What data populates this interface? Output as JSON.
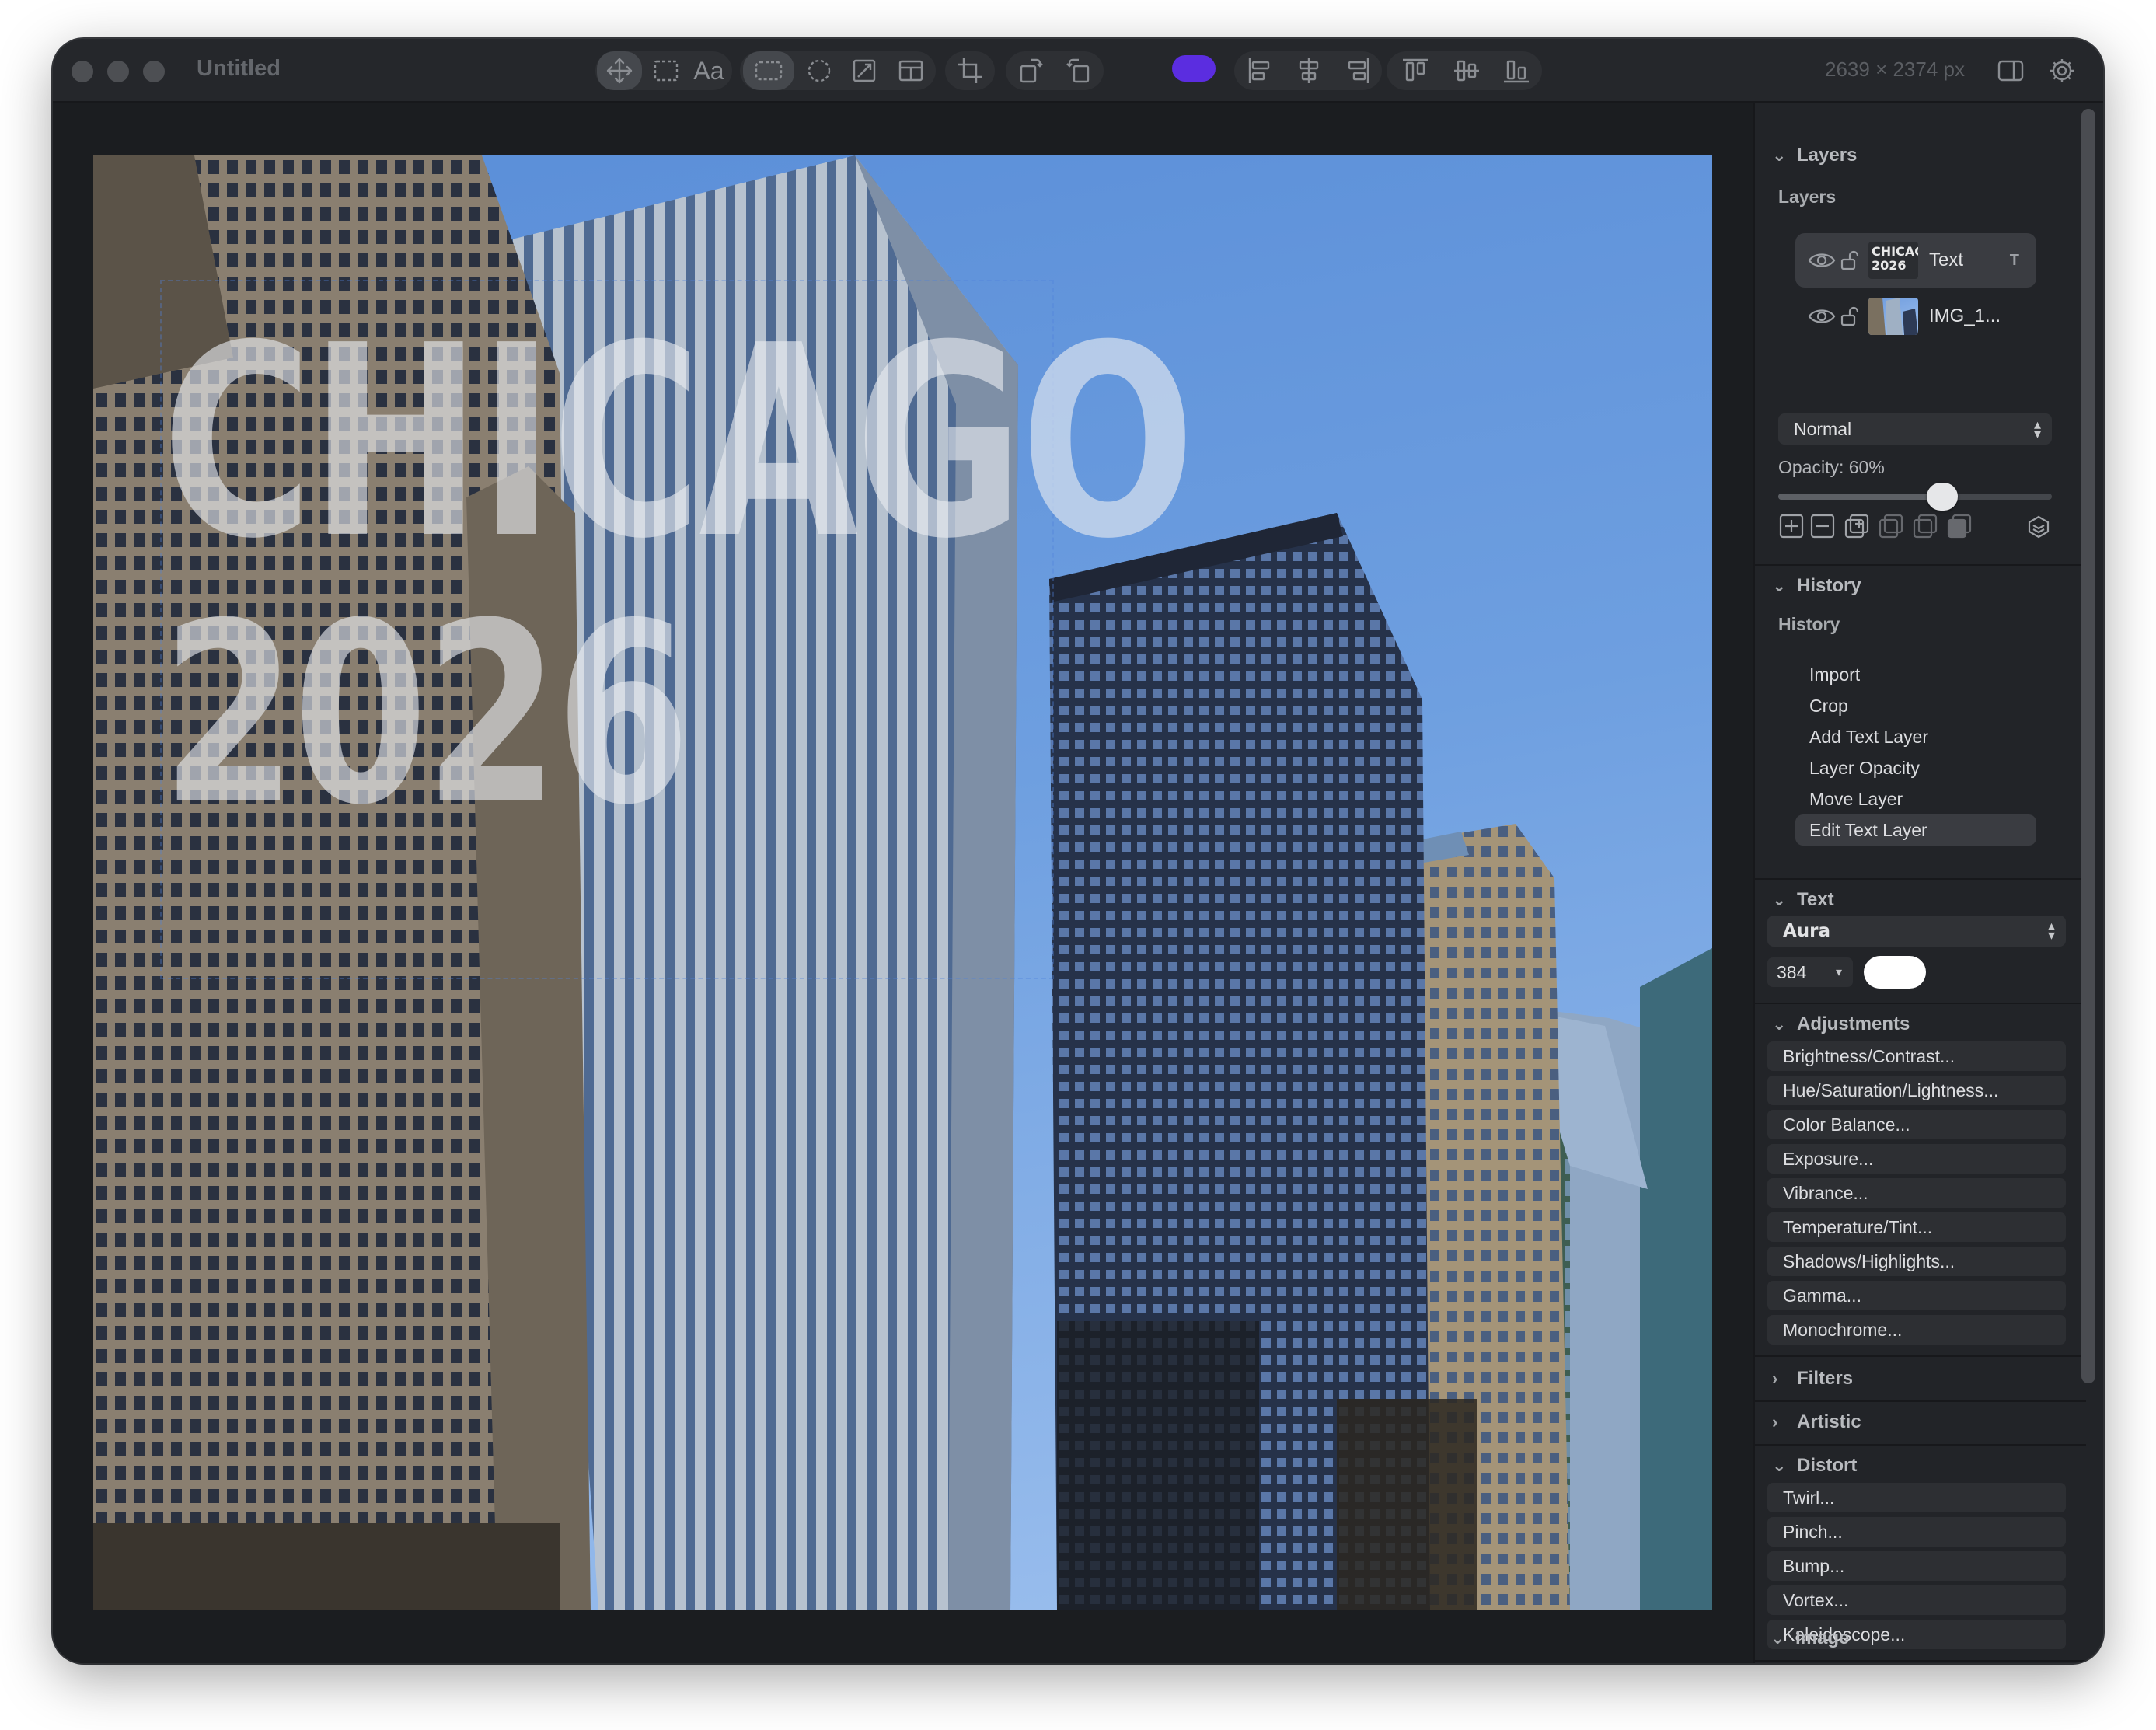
{
  "window": {
    "title": "Untitled",
    "dimensions": "2639 × 2374 px",
    "accent_color": "#5b2de0"
  },
  "toolbar": {
    "tools": [
      "move-icon",
      "marquee-select-icon",
      "text-tool-icon",
      "rect-select-icon",
      "ellipse-select-icon",
      "transform-icon",
      "layout-icon",
      "crop-icon",
      "rotate-left-icon",
      "rotate-right-icon",
      "color-swatch",
      "align-left-icon",
      "align-center-h-icon",
      "align-right-icon",
      "align-top-icon",
      "align-center-v-icon",
      "align-bottom-icon"
    ],
    "text_tool_label": "Aa"
  },
  "canvas": {
    "overlay_line1": "CHICAGO",
    "overlay_line2": "2026"
  },
  "layers": {
    "header": "Layers",
    "label": "Layers",
    "items": [
      {
        "name": "Text",
        "kind": "T",
        "thumb_line1": "CHICAGO",
        "thumb_line2": "2026",
        "selected": true
      },
      {
        "name": "IMG_1...",
        "kind": "",
        "selected": false
      }
    ],
    "blend_mode": "Normal",
    "opacity_label": "Opacity: 60%",
    "opacity": 0.6
  },
  "history": {
    "header": "History",
    "label": "History",
    "items": [
      "Import",
      "Crop",
      "Add Text Layer",
      "Layer Opacity",
      "Move Layer",
      "Edit Text Layer"
    ],
    "selected_index": 5
  },
  "text": {
    "header": "Text",
    "font": "Aura",
    "size": "384",
    "color": "#ffffff"
  },
  "adjustments": {
    "header": "Adjustments",
    "items": [
      "Brightness/Contrast...",
      "Hue/Saturation/Lightness...",
      "Color Balance...",
      "Exposure...",
      "Vibrance...",
      "Temperature/Tint...",
      "Shadows/Highlights...",
      "Gamma...",
      "Monochrome..."
    ]
  },
  "filters": {
    "header": "Filters"
  },
  "artistic": {
    "header": "Artistic"
  },
  "distort": {
    "header": "Distort",
    "items": [
      "Twirl...",
      "Pinch...",
      "Bump...",
      "Vortex...",
      "Kaleidoscope..."
    ]
  },
  "image": {
    "header": "Image"
  }
}
